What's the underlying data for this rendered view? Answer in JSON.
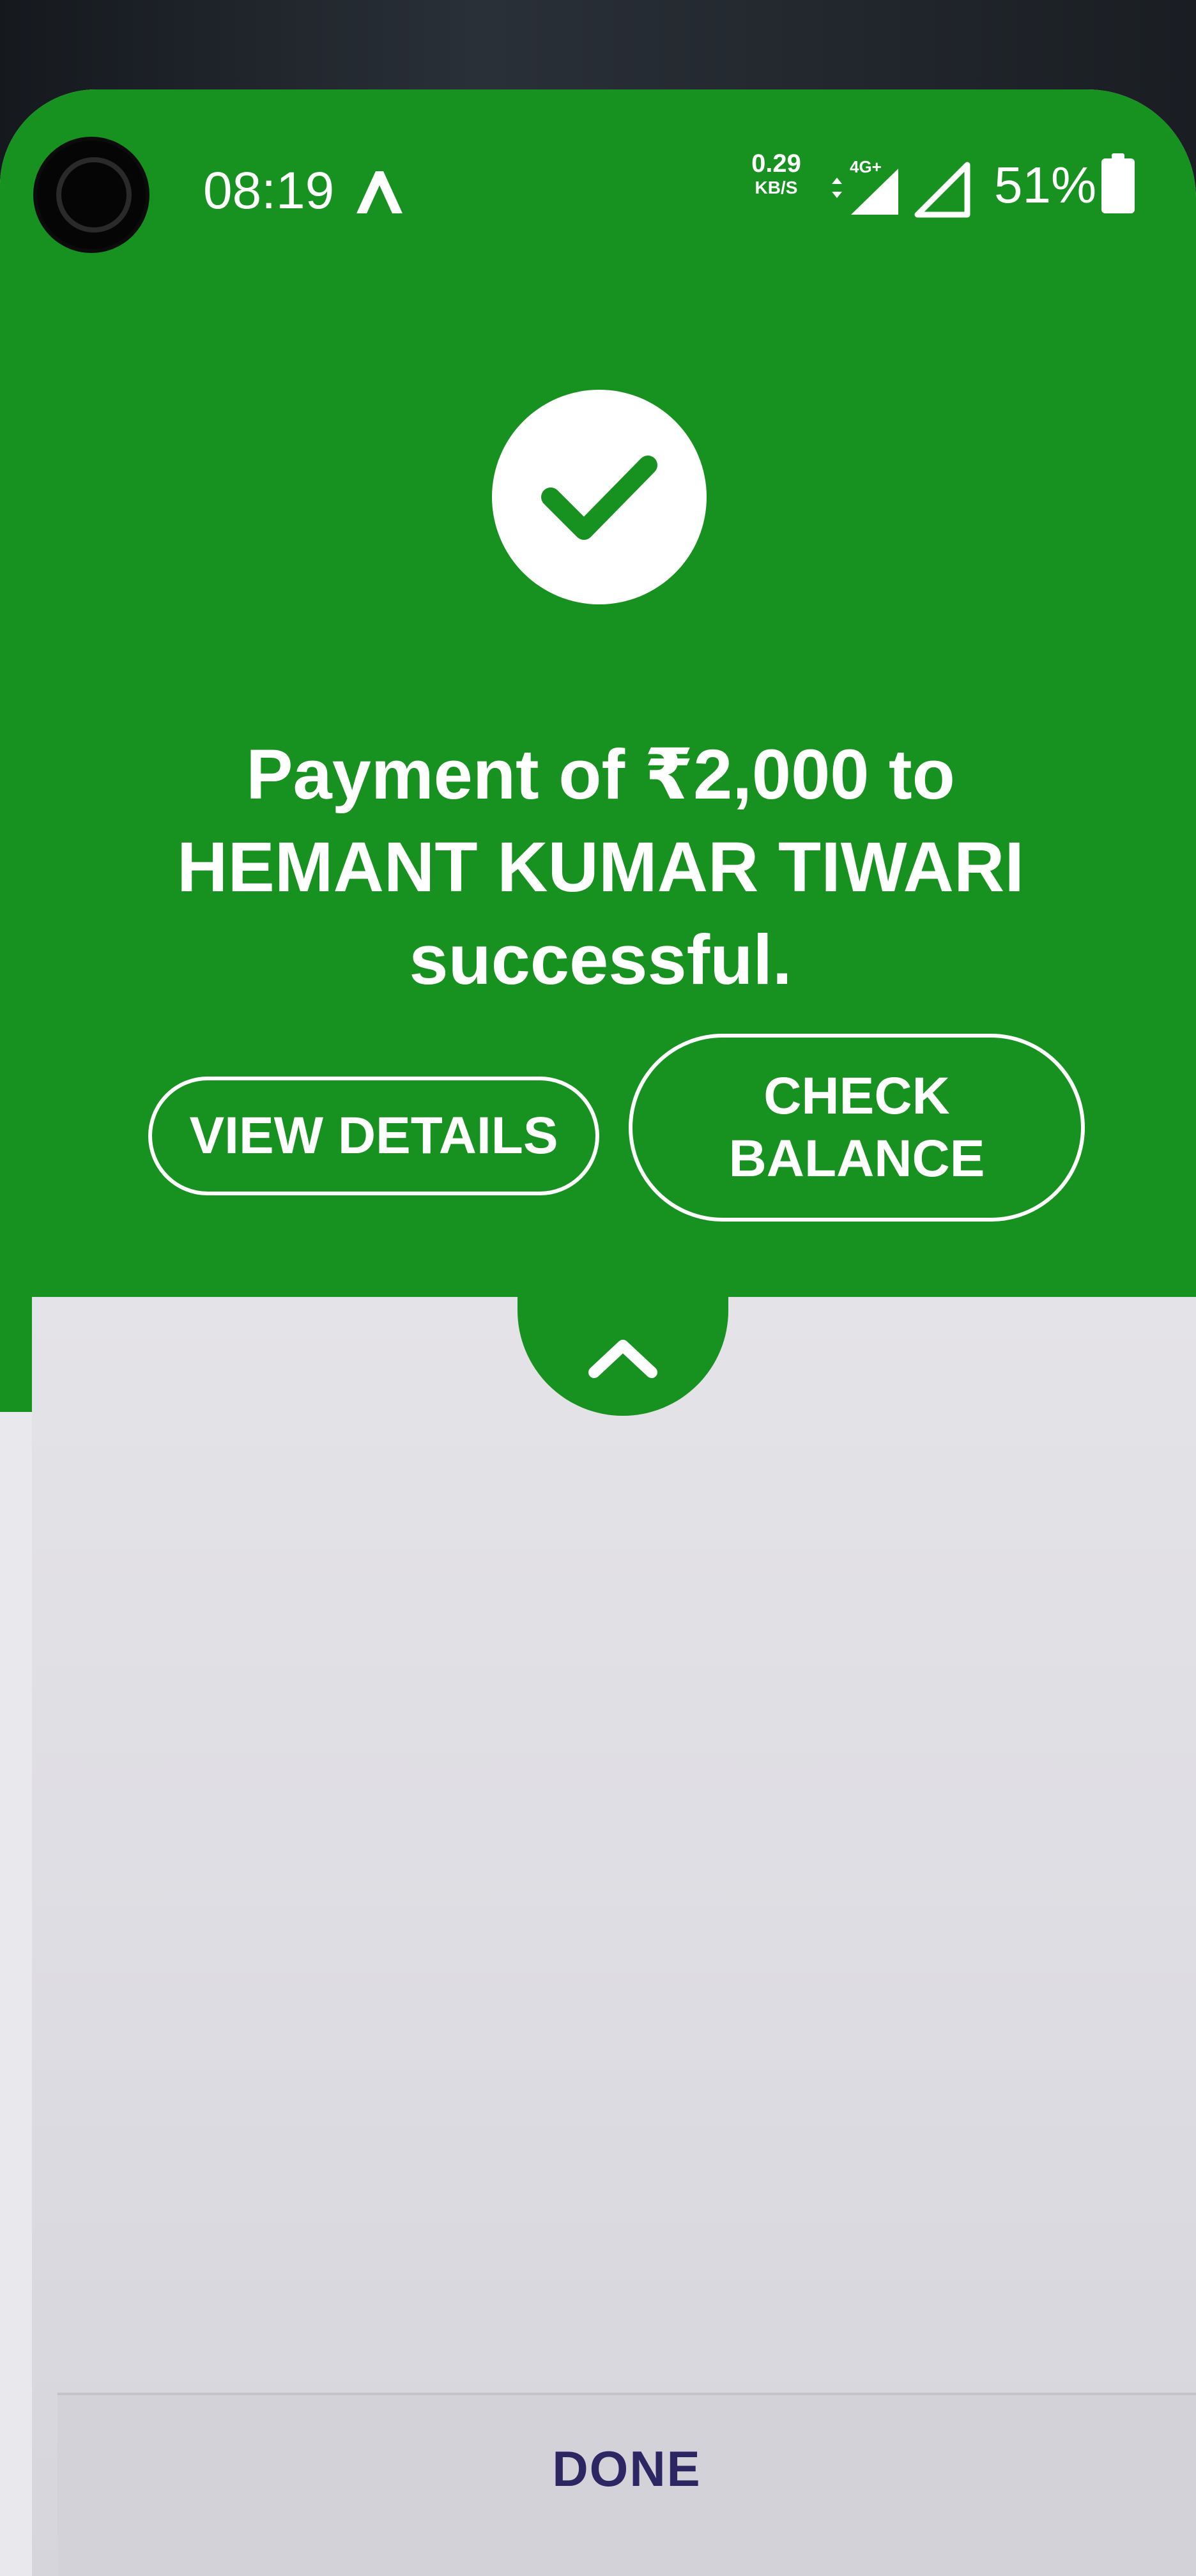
{
  "status_bar": {
    "time": "08:19",
    "net_speed_value": "0.29",
    "net_speed_unit": "KB/S",
    "network_type": "4G+",
    "battery_percent": "51%"
  },
  "icons": {
    "app_notification": "arrow-logo-icon",
    "check": "check-icon",
    "expand": "chevron-up-icon"
  },
  "colors": {
    "success_green": "#17911f",
    "done_text": "#2c2663"
  },
  "success": {
    "line1": "Payment of ₹2,000 to",
    "line2": "HEMANT KUMAR TIWARI",
    "line3": "successful."
  },
  "actions": {
    "view_details": "VIEW DETAILS",
    "check_balance_line1": "CHECK",
    "check_balance_line2": "BALANCE"
  },
  "footer": {
    "done_label": "DONE"
  }
}
